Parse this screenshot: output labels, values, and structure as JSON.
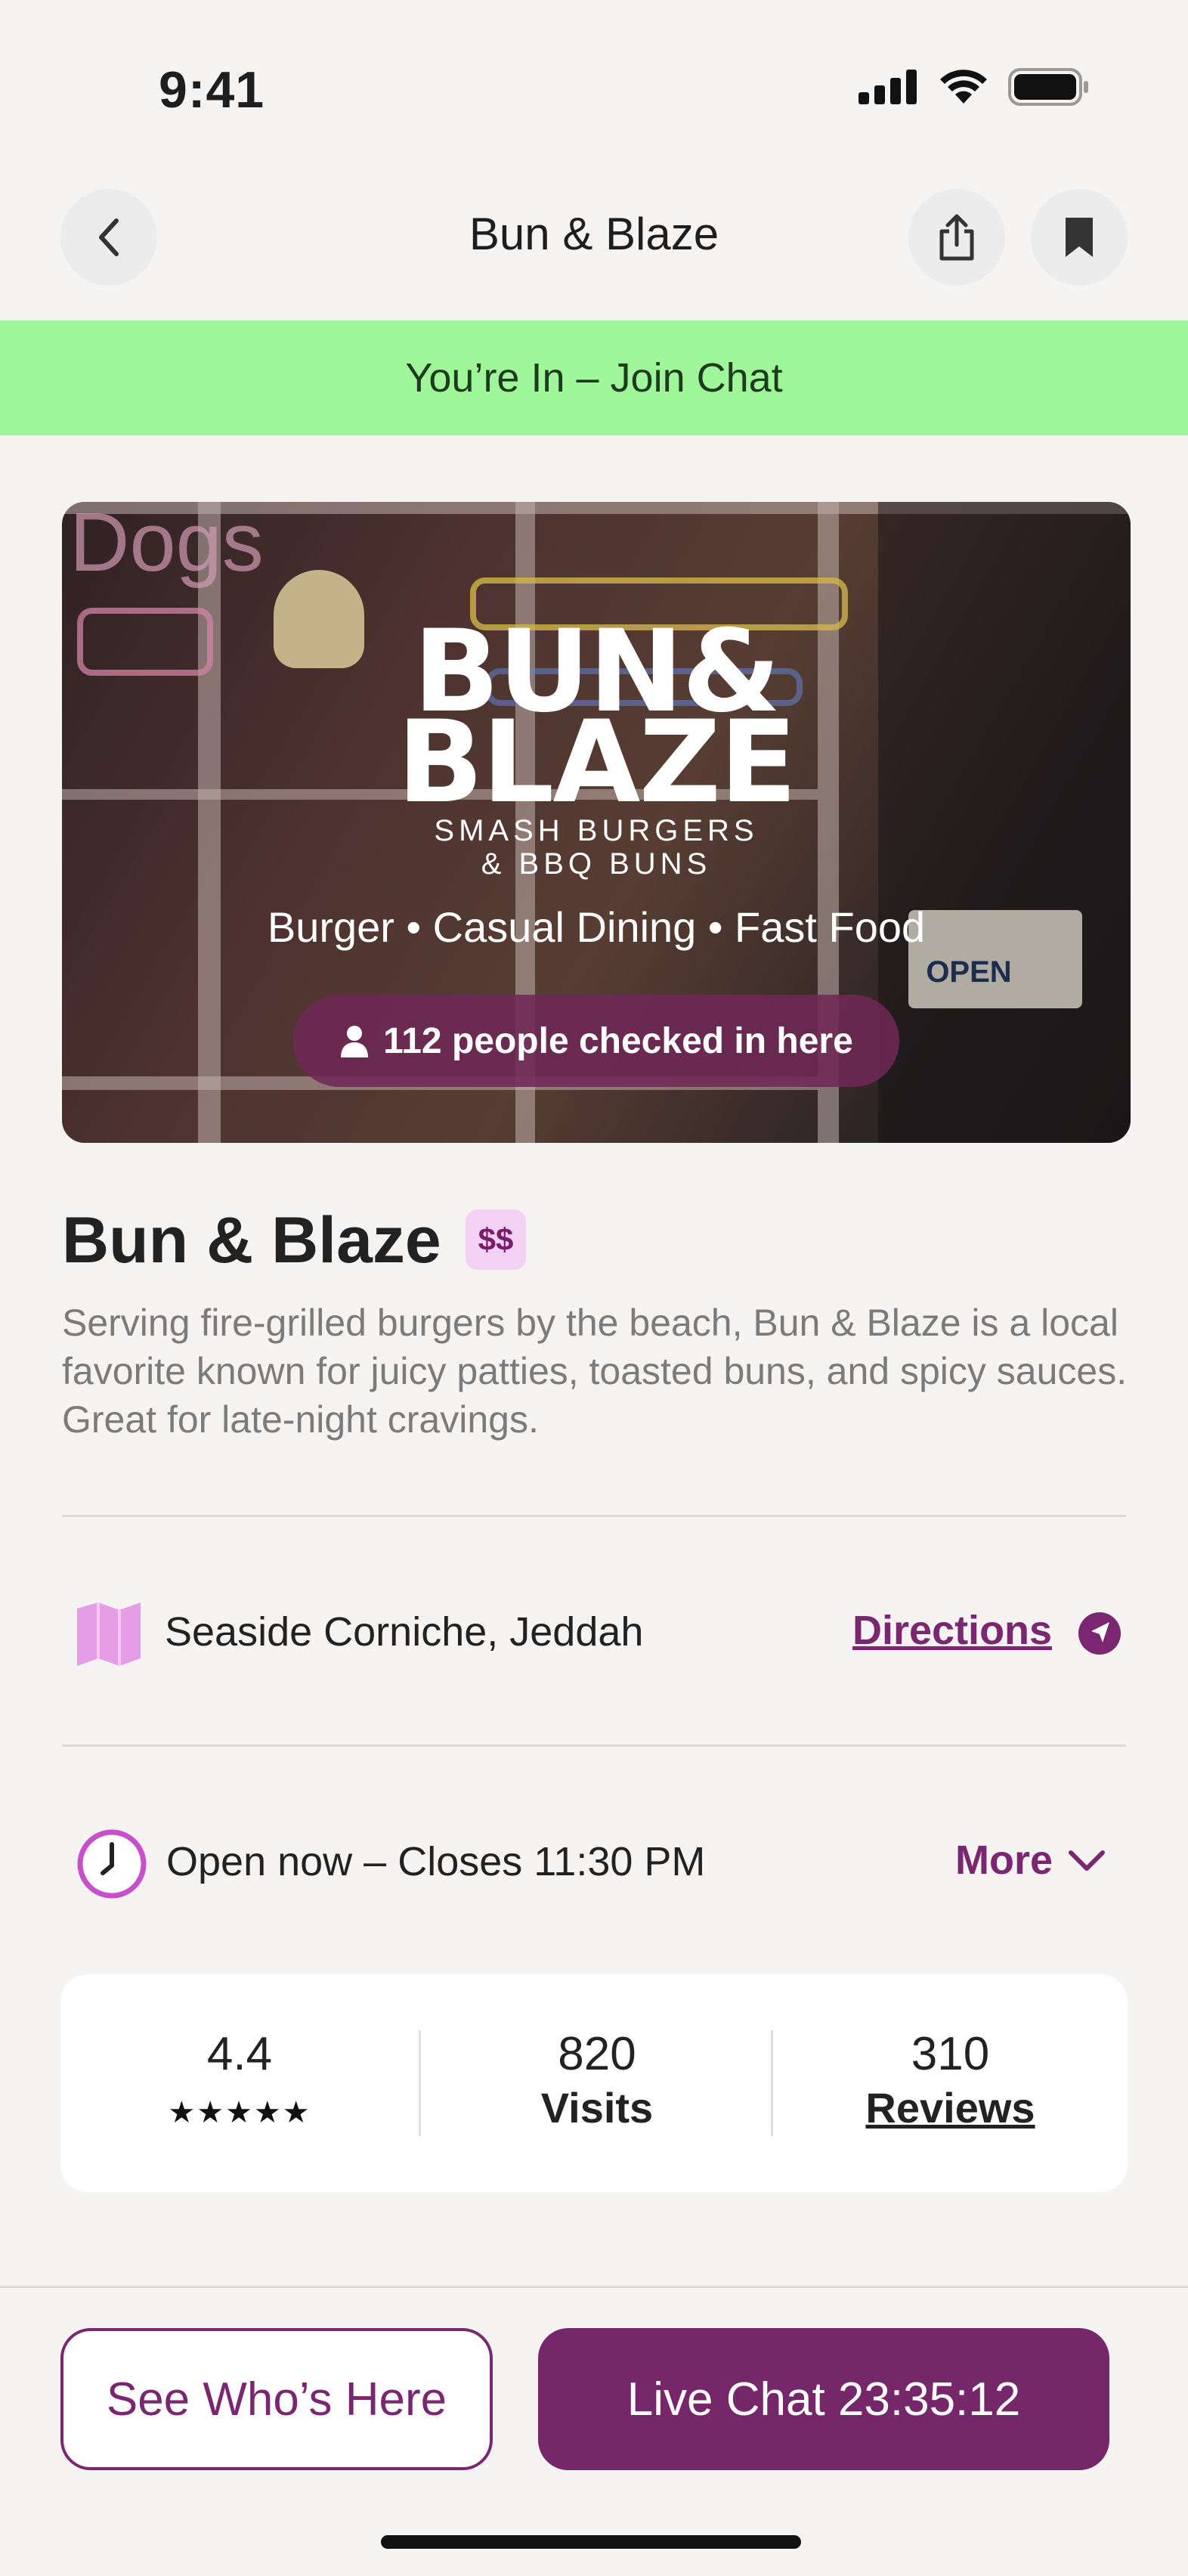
{
  "status_bar": {
    "time": "9:41",
    "icons": [
      "cellular-signal-icon",
      "wifi-icon",
      "battery-icon"
    ]
  },
  "nav": {
    "title": "Bun & Blaze",
    "back_icon": "chevron-left-icon",
    "share_icon": "share-icon",
    "bookmark_icon": "bookmark-icon"
  },
  "banner": {
    "label": "You’re In – Join Chat",
    "color": "#9ff79a"
  },
  "hero": {
    "logo_line1": "BUN&",
    "logo_line2": "BLAZE",
    "logo_sub_line1": "SMASH BURGERS",
    "logo_sub_line2": "& BBQ BUNS",
    "categories": "Burger • Casual Dining • Fast Food",
    "checkin_text": "112 people checked in here",
    "checkin_icon": "person-icon",
    "sign_text": "OPEN",
    "neon_text": "Dogs"
  },
  "venue": {
    "name": "Bun & Blaze",
    "price": "$$",
    "description": "Serving fire-grilled burgers by the beach, Bun & Blaze is a local favorite known for juicy patties, toasted buns, and spicy sauces. Great for late-night cravings."
  },
  "location": {
    "address": "Seaside Corniche, Jeddah",
    "directions_label": "Directions",
    "map_icon": "map-icon",
    "navigate_icon": "navigation-arrow-icon"
  },
  "hours": {
    "status": "Open now – Closes 11:30 PM",
    "more_label": "More",
    "clock_icon": "clock-icon"
  },
  "stats": {
    "rating": "4.4",
    "stars": "★★★★★",
    "visits_value": "820",
    "visits_label": "Visits",
    "reviews_value": "310",
    "reviews_label": "Reviews"
  },
  "actions": {
    "see_who_label": "See Who’s Here",
    "live_chat_label": "Live Chat 23:35:12"
  },
  "colors": {
    "accent": "#762769",
    "background": "#f6f4f2",
    "badge_bg": "#f3d2f5"
  }
}
